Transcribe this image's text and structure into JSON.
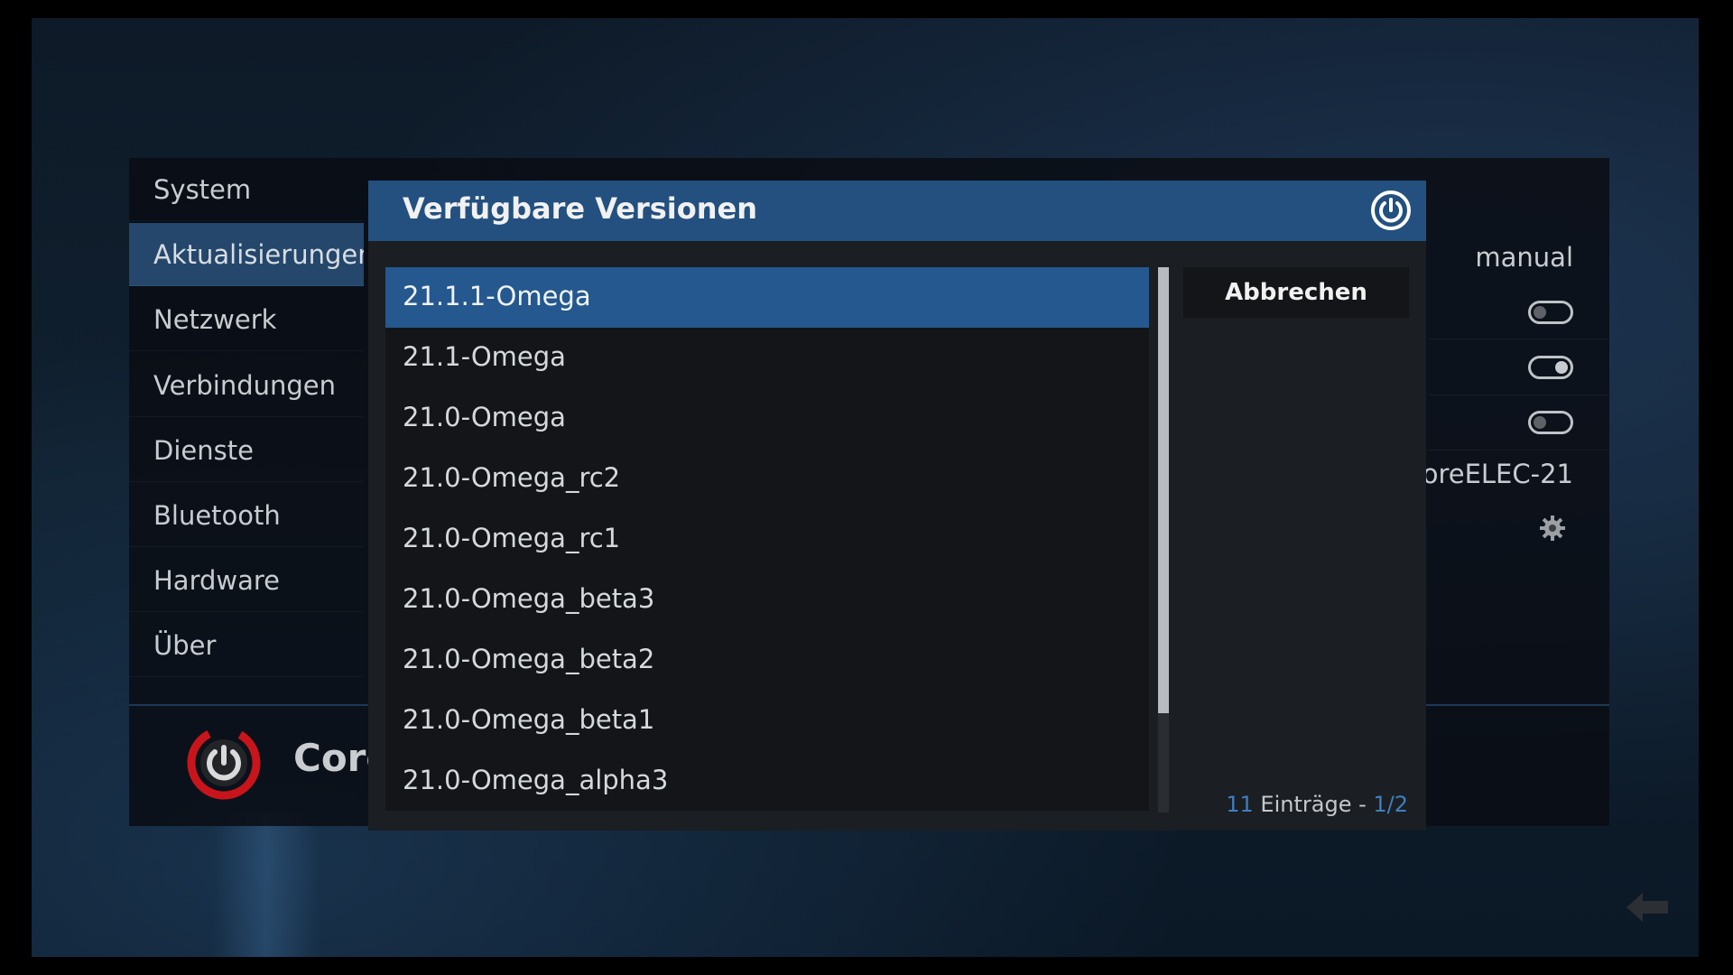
{
  "sidebar": {
    "items": [
      {
        "label": "System"
      },
      {
        "label": "Aktualisierungen"
      },
      {
        "label": "Netzwerk"
      },
      {
        "label": "Verbindungen"
      },
      {
        "label": "Dienste"
      },
      {
        "label": "Bluetooth"
      },
      {
        "label": "Hardware"
      },
      {
        "label": "Über"
      }
    ],
    "active_index": 1
  },
  "brand": {
    "logo_text": "Core",
    "logo_color": "#c8151b"
  },
  "settings_values": {
    "update_mode": "manual",
    "toggle_1": false,
    "toggle_2": true,
    "toggle_3": false,
    "update_channel": "CoreELEC-21"
  },
  "dialog": {
    "title": "Verfügbare Versionen",
    "header_color": "#23507f",
    "items": [
      "21.1.1-Omega",
      "21.1-Omega",
      "21.0-Omega",
      "21.0-Omega_rc2",
      "21.0-Omega_rc1",
      "21.0-Omega_beta3",
      "21.0-Omega_beta2",
      "21.0-Omega_beta1",
      "21.0-Omega_alpha3"
    ],
    "selected_index": 0,
    "cancel_label": "Abbrechen",
    "count": {
      "total": "11",
      "label": " Einträge - ",
      "page": "1/2"
    }
  },
  "icons": {
    "power": "power-icon",
    "gear": "gear-icon",
    "back": "back-arrow-icon"
  }
}
